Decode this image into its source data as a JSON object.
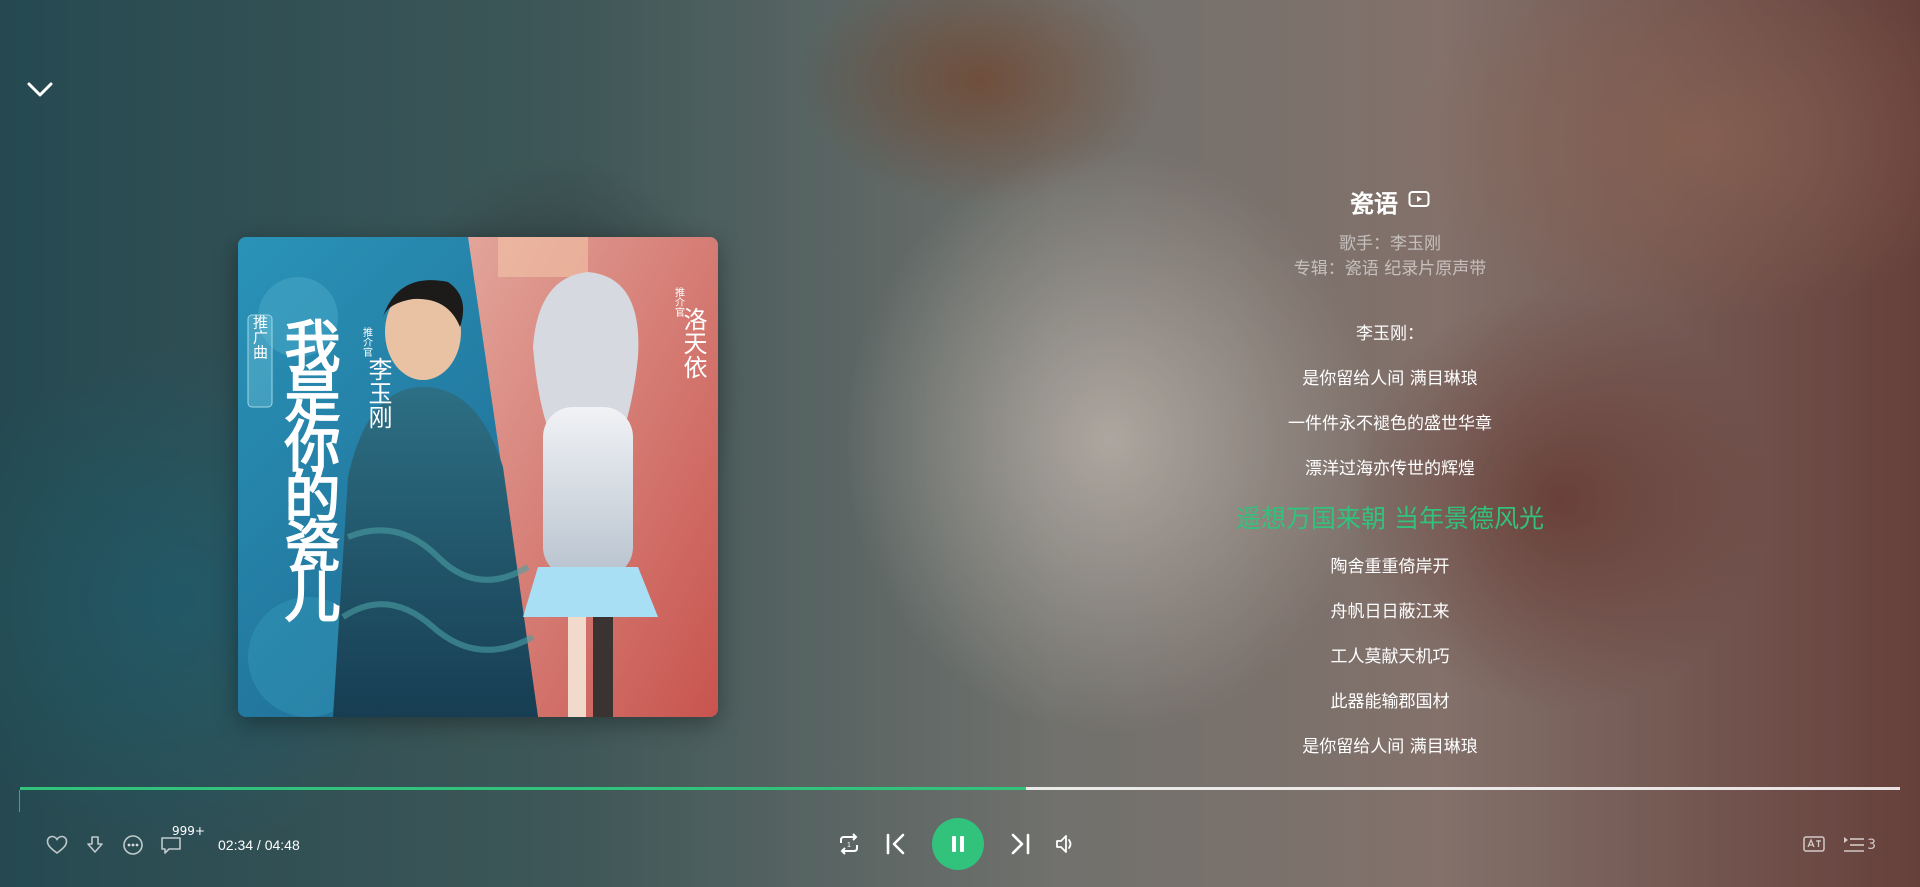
{
  "song": {
    "title": "瓷语",
    "singer_line": "歌手：李玉刚",
    "album_line": "专辑：瓷语 纪录片原声带"
  },
  "cover_text": {
    "tag": "推广曲",
    "calligraphy": "我是你的瓷儿",
    "left_role": "推介官",
    "left_name": "李玉刚",
    "right_role": "推介官",
    "right_name": "洛天依"
  },
  "lyrics": [
    {
      "text": "李玉刚：",
      "current": false
    },
    {
      "text": "是你留给人间 满目琳琅",
      "current": false
    },
    {
      "text": "一件件永不褪色的盛世华章",
      "current": false
    },
    {
      "text": "漂洋过海亦传世的辉煌",
      "current": false
    },
    {
      "text": "遥想万国来朝 当年景德风光",
      "current": true
    },
    {
      "text": "陶舍重重倚岸开",
      "current": false
    },
    {
      "text": "舟帆日日蔽江来",
      "current": false
    },
    {
      "text": "工人莫献天机巧",
      "current": false
    },
    {
      "text": "此器能输郡国材",
      "current": false
    },
    {
      "text": "是你留给人间 满目琳琅",
      "current": false
    }
  ],
  "player": {
    "comment_count": "999+",
    "time": "02:34 / 04:48",
    "progress": 0.535,
    "playlist_count": "3"
  },
  "colors": {
    "accent": "#31c27c",
    "text": "#ffffff",
    "muted": "rgba(255,255,255,0.55)"
  },
  "icons": [
    "chevron-down-icon",
    "mv-icon",
    "heart-icon",
    "download-icon",
    "more-icon",
    "comment-icon",
    "repeat-icon",
    "previous-icon",
    "pause-icon",
    "next-icon",
    "volume-icon",
    "lyrics-translate-icon",
    "playlist-icon"
  ]
}
